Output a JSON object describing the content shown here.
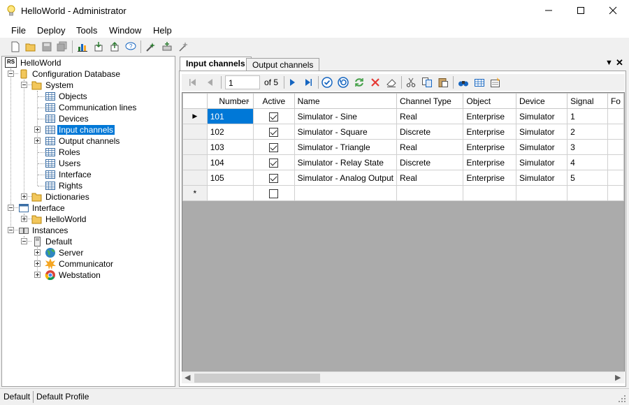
{
  "window": {
    "title": "HelloWorld - Administrator"
  },
  "menu": [
    "File",
    "Deploy",
    "Tools",
    "Window",
    "Help"
  ],
  "toolbar_icons": [
    "new-icon",
    "open-icon",
    "save-icon",
    "save-all-icon",
    "chart-icon",
    "import-icon",
    "export-icon",
    "help-icon",
    "deploy-icon",
    "add-icon",
    "wizard-icon"
  ],
  "tree": {
    "root_badge": "RS",
    "nodes": [
      {
        "label": "HelloWorld",
        "icon": "rs-icon"
      },
      {
        "label": "Configuration Database",
        "icon": "database-icon"
      },
      {
        "label": "System",
        "icon": "folder-open-icon"
      },
      {
        "label": "Objects",
        "icon": "table-icon"
      },
      {
        "label": "Communication lines",
        "icon": "table-icon"
      },
      {
        "label": "Devices",
        "icon": "table-icon"
      },
      {
        "label": "Input channels",
        "icon": "table-icon"
      },
      {
        "label": "Output channels",
        "icon": "table-icon"
      },
      {
        "label": "Roles",
        "icon": "table-icon"
      },
      {
        "label": "Users",
        "icon": "table-icon"
      },
      {
        "label": "Interface",
        "icon": "table-icon"
      },
      {
        "label": "Rights",
        "icon": "table-icon"
      },
      {
        "label": "Dictionaries",
        "icon": "folder-icon"
      },
      {
        "label": "Interface",
        "icon": "window-icon"
      },
      {
        "label": "HelloWorld",
        "icon": "folder-icon"
      },
      {
        "label": "Instances",
        "icon": "instances-icon"
      },
      {
        "label": "Default",
        "icon": "server-box-icon"
      },
      {
        "label": "Server",
        "icon": "globe-icon"
      },
      {
        "label": "Communicator",
        "icon": "star-icon"
      },
      {
        "label": "Webstation",
        "icon": "chrome-icon"
      }
    ]
  },
  "tabs": [
    {
      "label": "Input channels",
      "active": true
    },
    {
      "label": "Output channels",
      "active": false
    }
  ],
  "navigator": {
    "position": "1",
    "of_text": "of 5"
  },
  "grid": {
    "columns": [
      "Number",
      "Active",
      "Name",
      "Channel Type",
      "Object",
      "Device",
      "Signal",
      "Fo"
    ],
    "rows": [
      {
        "number": "101",
        "active": true,
        "name": "Simulator - Sine",
        "type": "Real",
        "object": "Enterprise",
        "device": "Simulator",
        "signal": "1"
      },
      {
        "number": "102",
        "active": true,
        "name": "Simulator - Square",
        "type": "Discrete",
        "object": "Enterprise",
        "device": "Simulator",
        "signal": "2"
      },
      {
        "number": "103",
        "active": true,
        "name": "Simulator - Triangle",
        "type": "Real",
        "object": "Enterprise",
        "device": "Simulator",
        "signal": "3"
      },
      {
        "number": "104",
        "active": true,
        "name": "Simulator - Relay State",
        "type": "Discrete",
        "object": "Enterprise",
        "device": "Simulator",
        "signal": "4"
      },
      {
        "number": "105",
        "active": true,
        "name": "Simulator - Analog Output",
        "type": "Real",
        "object": "Enterprise",
        "device": "Simulator",
        "signal": "5"
      }
    ],
    "new_row_marker": "*",
    "current_row_marker": "▶"
  },
  "status": {
    "left": "Default",
    "right": "Default Profile"
  },
  "colors": {
    "selection": "#0078d7",
    "grid_empty": "#ababab"
  }
}
